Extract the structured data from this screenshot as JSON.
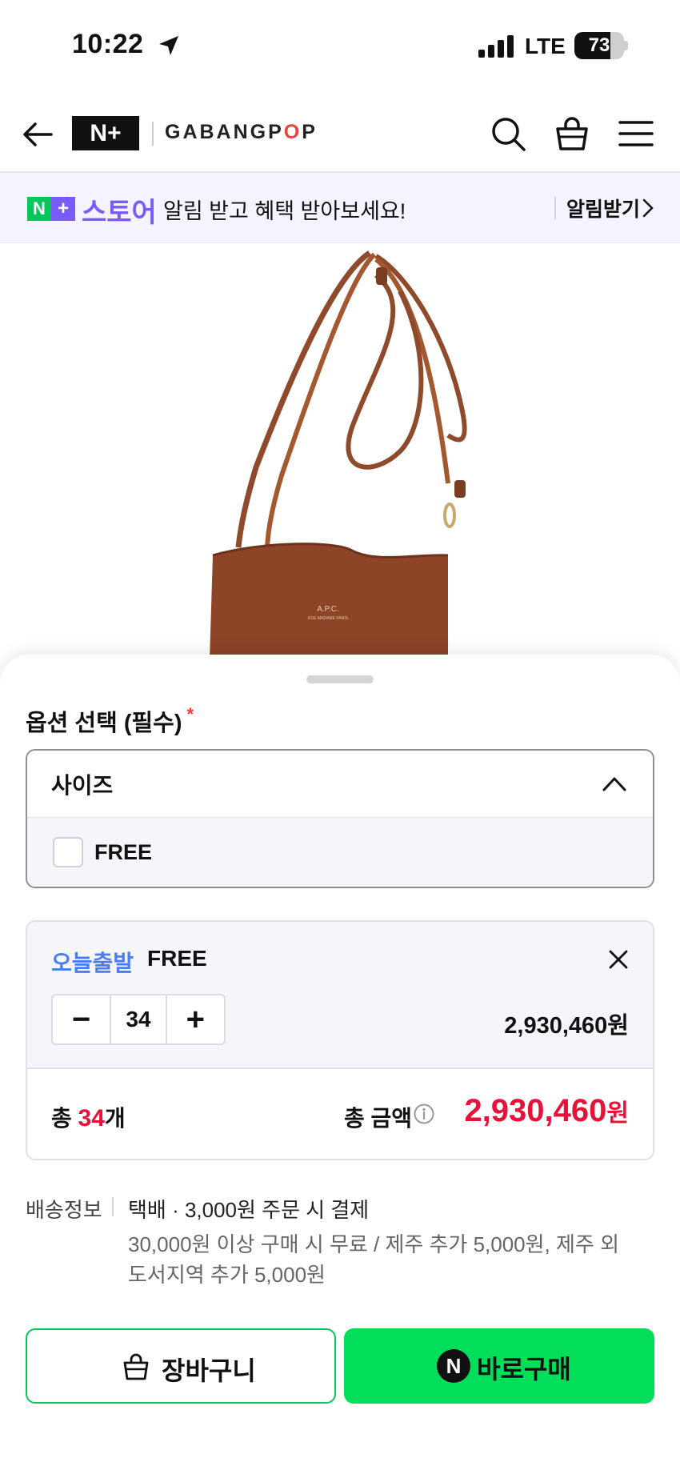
{
  "status_bar": {
    "time": "10:22",
    "network": "LTE",
    "battery": "73",
    "battery_level": 0.73
  },
  "header": {
    "brand_logo": "N+",
    "brand_name_prefix": "GABANGP",
    "brand_name_o": "O",
    "brand_name_suffix": "P",
    "icons": [
      "back-arrow-icon",
      "search-icon",
      "shopping-bag-icon",
      "menu-icon"
    ]
  },
  "banner": {
    "logo_n": "N",
    "logo_plus": "+",
    "store": "스토어",
    "message": "알림 받고 혜택 받아보세요!",
    "cta": "알림받기"
  },
  "options": {
    "title": "옵션 선택 (필수)",
    "required_mark": "*",
    "select_label": "사이즈",
    "option_label": "FREE"
  },
  "selected_item": {
    "shipping_tag": "오늘출발",
    "option": "FREE",
    "decrement": "−",
    "quantity": "34",
    "increment": "+",
    "price": "2,930,460원"
  },
  "totals": {
    "count_prefix": "총 ",
    "count": "34",
    "count_suffix": "개",
    "amount_label": "총 금액",
    "amount": "2,930,460",
    "amount_unit": "원"
  },
  "delivery": {
    "label": "배송정보",
    "main": "택배 · 3,000원 주문 시 결제",
    "sub": "30,000원 이상 구매 시 무료 / 제주 추가 5,000원, 제주 외 도서지역 추가 5,000원"
  },
  "actions": {
    "cart": "장바구니",
    "buy_icon": "N",
    "buy": "바로구매"
  },
  "colors": {
    "naver_green": "#03c75a",
    "buy_green": "#03de5a",
    "accent_red": "#e8113a",
    "banner_purple": "#7a5af8",
    "tag_blue": "#4a7cf6"
  }
}
